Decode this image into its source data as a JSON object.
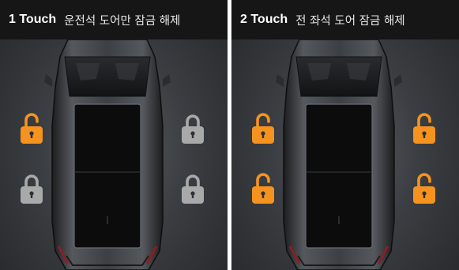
{
  "panels": [
    {
      "touch_label": "1 Touch",
      "description": "운전석 도어만 잠금 해제",
      "locks": {
        "front_left": "unlocked",
        "front_right": "locked",
        "rear_left": "locked",
        "rear_right": "locked"
      }
    },
    {
      "touch_label": "2 Touch",
      "description": "전 좌석 도어 잠금 해제",
      "locks": {
        "front_left": "unlocked",
        "front_right": "unlocked",
        "rear_left": "unlocked",
        "rear_right": "unlocked"
      }
    }
  ],
  "colors": {
    "unlocked": "#f5931e",
    "locked": "#a9a9a9",
    "header_bg": "#161616"
  },
  "icons": {
    "unlocked": "unlocked-padlock-icon",
    "locked": "locked-padlock-icon"
  }
}
